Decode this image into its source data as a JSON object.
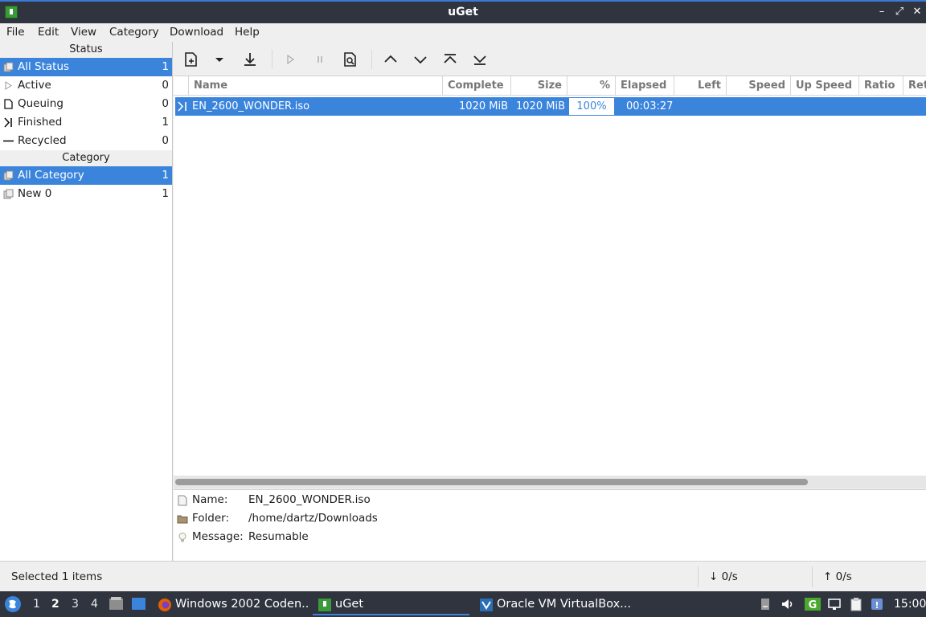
{
  "window": {
    "title": "uGet"
  },
  "menu": [
    "File",
    "Edit",
    "View",
    "Category",
    "Download",
    "Help"
  ],
  "sidebar": {
    "status_header": "Status",
    "status_items": [
      {
        "label": "All Status",
        "count": "1"
      },
      {
        "label": "Active",
        "count": "0"
      },
      {
        "label": "Queuing",
        "count": "0"
      },
      {
        "label": "Finished",
        "count": "1"
      },
      {
        "label": "Recycled",
        "count": "0"
      }
    ],
    "category_header": "Category",
    "category_items": [
      {
        "label": "All Category",
        "count": "1"
      },
      {
        "label": "New 0",
        "count": "1"
      }
    ]
  },
  "table": {
    "columns": [
      "Name",
      "Complete",
      "Size",
      "%",
      "Elapsed",
      "Left",
      "Speed",
      "Up Speed",
      "Ratio",
      "Ret"
    ],
    "rows": [
      {
        "name": "EN_2600_WONDER.iso",
        "complete": "1020 MiB",
        "size": "1020 MiB",
        "percent": "100%",
        "elapsed": "00:03:27"
      }
    ]
  },
  "info": {
    "name_label": "Name:",
    "name_value": "EN_2600_WONDER.iso",
    "folder_label": "Folder:",
    "folder_value": "/home/dartz/Downloads",
    "message_label": "Message:",
    "message_value": "Resumable"
  },
  "statusbar": {
    "selected": "Selected 1 items",
    "down_speed": "↓  0/s",
    "up_speed": "↑  0/s"
  },
  "taskbar": {
    "workspaces": [
      "1",
      "2",
      "3",
      "4"
    ],
    "tasks": [
      {
        "label": "Windows 2002 Coden..."
      },
      {
        "label": "uGet"
      },
      {
        "label": "Oracle VM VirtualBox..."
      }
    ],
    "clock": "15:00"
  },
  "colors": {
    "selection": "#3b84dc",
    "titlebar": "#2f343f",
    "accent": "#3b7ad9"
  }
}
